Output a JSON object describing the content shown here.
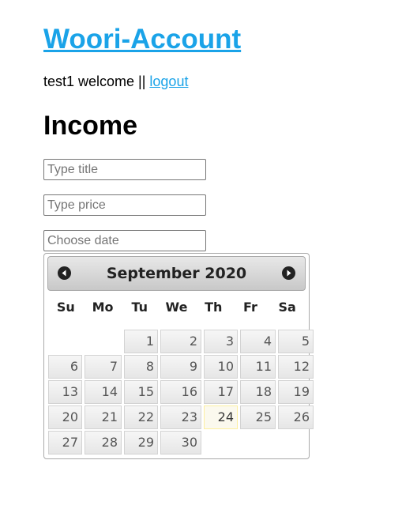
{
  "app": {
    "title": "Woori-Account"
  },
  "user_bar": {
    "welcome_text": "test1 welcome || ",
    "logout_label": "logout"
  },
  "section": {
    "title": "Income"
  },
  "form": {
    "title_placeholder": "Type title",
    "title_value": "",
    "price_placeholder": "Type price",
    "price_value": "",
    "date_placeholder": "Choose date",
    "date_value": ""
  },
  "datepicker": {
    "month_year": "September 2020",
    "prev_icon": "chevron-left-circle-icon",
    "next_icon": "chevron-right-circle-icon",
    "weekdays": [
      "Su",
      "Mo",
      "Tu",
      "We",
      "Th",
      "Fr",
      "Sa"
    ],
    "leading_blanks": 2,
    "days": [
      "1",
      "2",
      "3",
      "4",
      "5",
      "6",
      "7",
      "8",
      "9",
      "10",
      "11",
      "12",
      "13",
      "14",
      "15",
      "16",
      "17",
      "18",
      "19",
      "20",
      "21",
      "22",
      "23",
      "24",
      "25",
      "26",
      "27",
      "28",
      "29",
      "30"
    ],
    "today": "24",
    "colors": {
      "today_bg": "#fbf9ee",
      "today_border": "#fcefa1"
    }
  },
  "colors": {
    "link": "#1aa3e8"
  }
}
